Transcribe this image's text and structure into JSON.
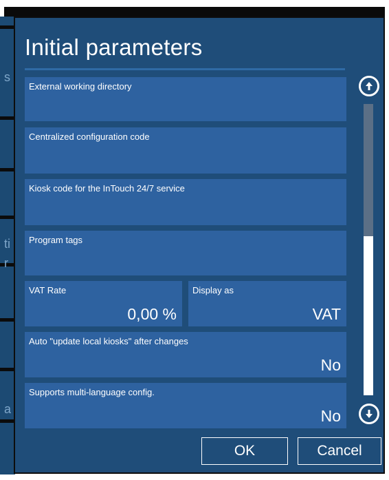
{
  "background": {
    "left_fragments": [
      "s",
      "ti",
      "r",
      "a"
    ]
  },
  "dialog": {
    "title": "Initial parameters",
    "fields": [
      {
        "label": "External working directory",
        "value": ""
      },
      {
        "label": "Centralized configuration code",
        "value": ""
      },
      {
        "label": "Kiosk code for the InTouch 24/7 service",
        "value": ""
      },
      {
        "label": "Program tags",
        "value": ""
      }
    ],
    "vat_rate": {
      "label": "VAT Rate",
      "value": "0,00 %"
    },
    "display_as": {
      "label": "Display as",
      "value": "VAT"
    },
    "auto_update": {
      "label": "Auto \"update local kiosks\" after changes",
      "value": "No"
    },
    "multi_language": {
      "label": "Supports multi-language config.",
      "value": "No"
    },
    "scroll": {
      "up_icon": "arrow-up-circle-icon",
      "down_icon": "arrow-down-circle-icon"
    },
    "buttons": {
      "ok": "OK",
      "cancel": "Cancel"
    }
  },
  "colors": {
    "dialog_bg": "#1f4d79",
    "field_bg": "#2e62a0",
    "scroll_thumb": "#5b6f86",
    "text": "#ffffff"
  }
}
